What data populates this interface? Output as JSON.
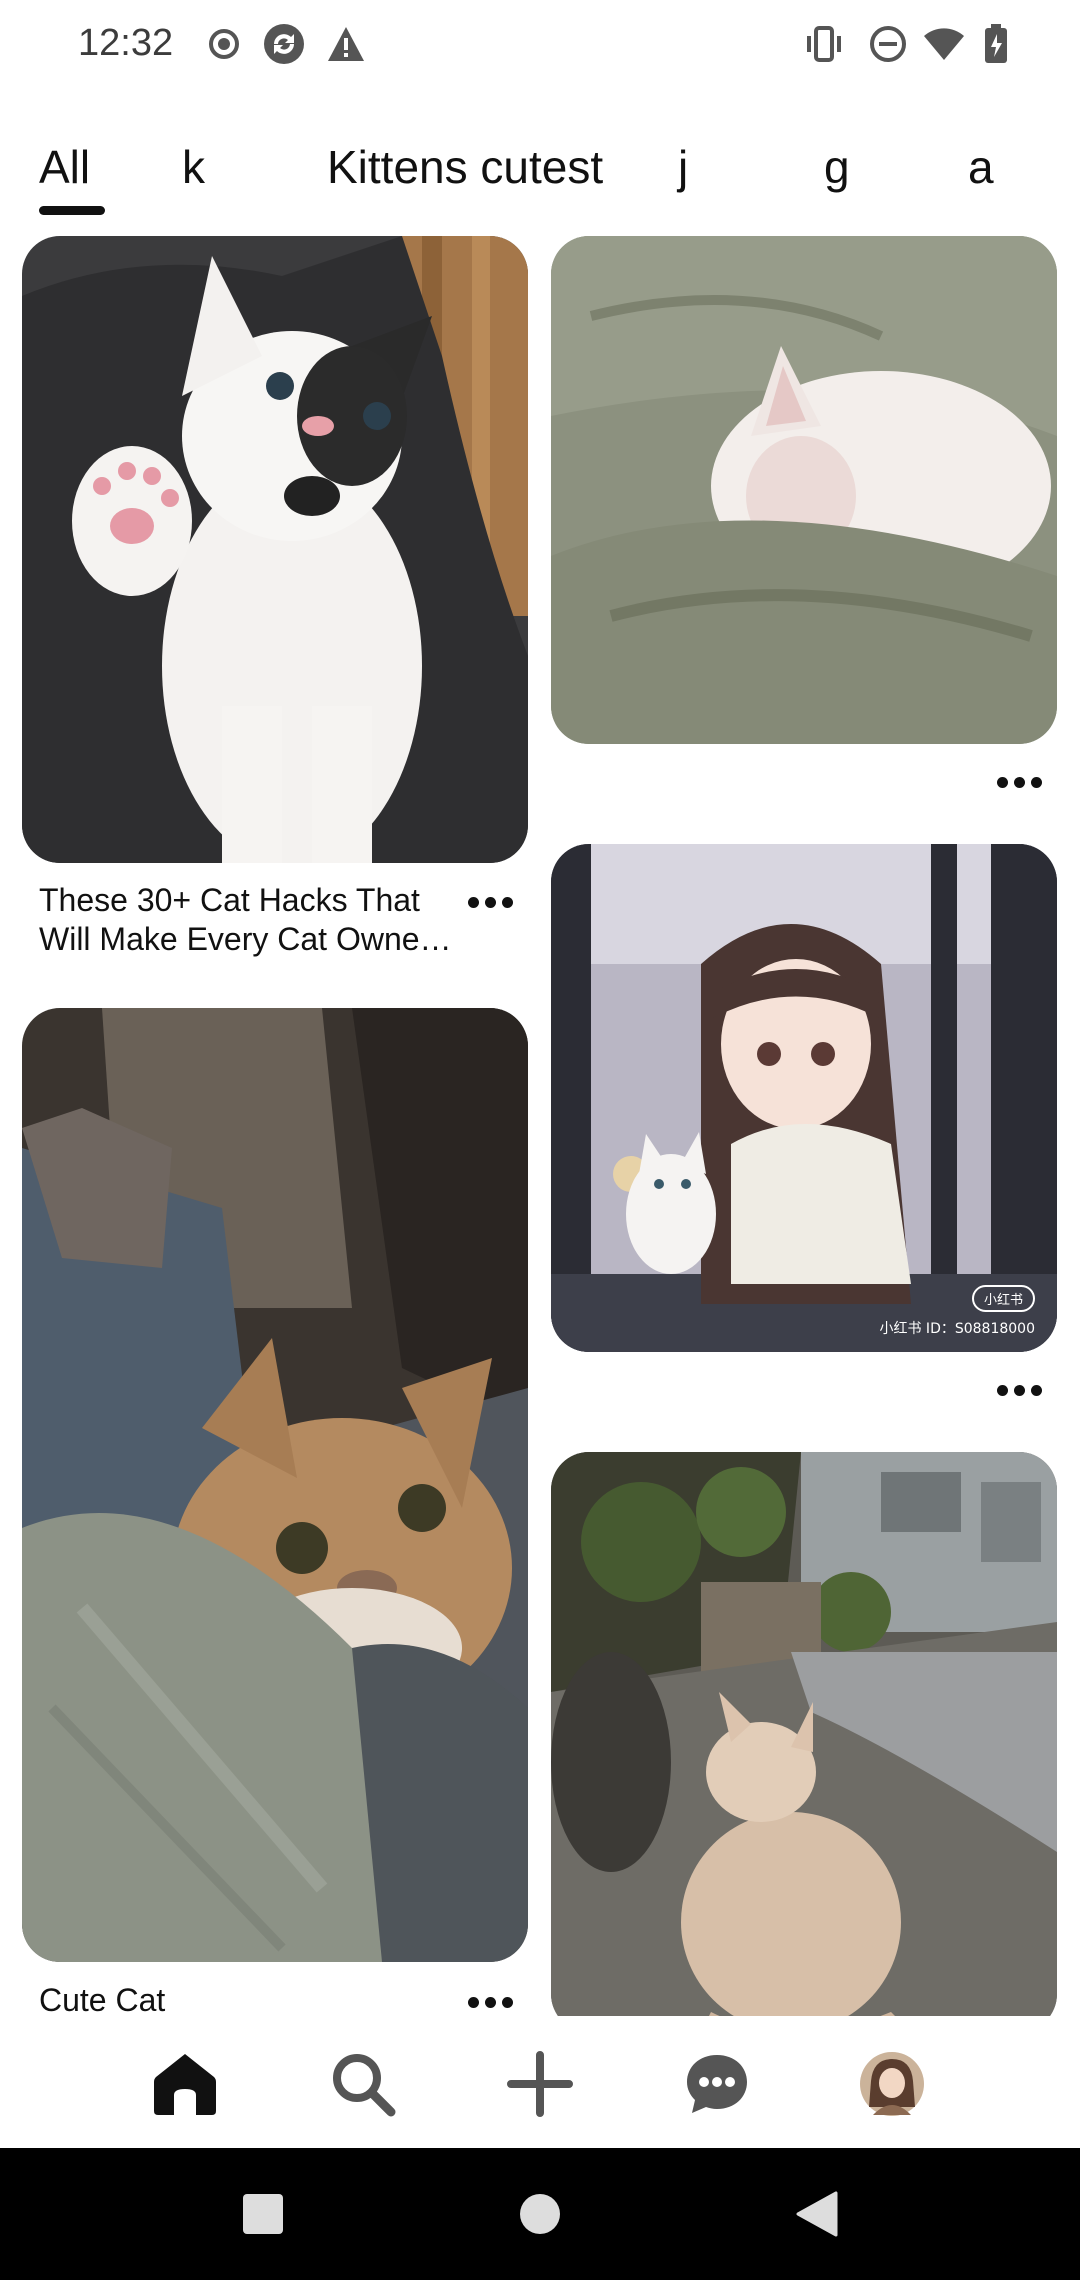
{
  "status_bar": {
    "time": "12:32",
    "left_icons": [
      "record-icon",
      "sync-icon",
      "warning-icon"
    ],
    "right_icons": [
      "vibrate-icon",
      "do-not-disturb-icon",
      "wifi-icon",
      "battery-charging-icon"
    ]
  },
  "tabs": [
    {
      "label": "All",
      "selected": true
    },
    {
      "label": "k"
    },
    {
      "label": "Kittens cutest"
    },
    {
      "label": "j"
    },
    {
      "label": "g"
    },
    {
      "label": "a"
    }
  ],
  "feed": {
    "pins": [
      {
        "caption_line1": "These 30+ Cat Hacks That",
        "caption_line2": "Will Make Every Cat Owne…"
      },
      {
        "caption_line1": "Cute Cat"
      },
      {
        "caption_line1": ""
      },
      {
        "watermark_badge": "小红书",
        "watermark_id": "小红书 ID：S08818000"
      },
      {
        "caption_line1": ""
      }
    ]
  },
  "bottom_nav": {
    "items": [
      "home-icon",
      "search-icon",
      "plus-icon",
      "messages-icon",
      "profile-avatar"
    ]
  },
  "system_nav": {
    "buttons": [
      "recents-square",
      "home-circle",
      "back-triangle"
    ]
  },
  "colors": {
    "accent": "#111111",
    "background": "#ffffff",
    "nav_icon": "#555555"
  }
}
